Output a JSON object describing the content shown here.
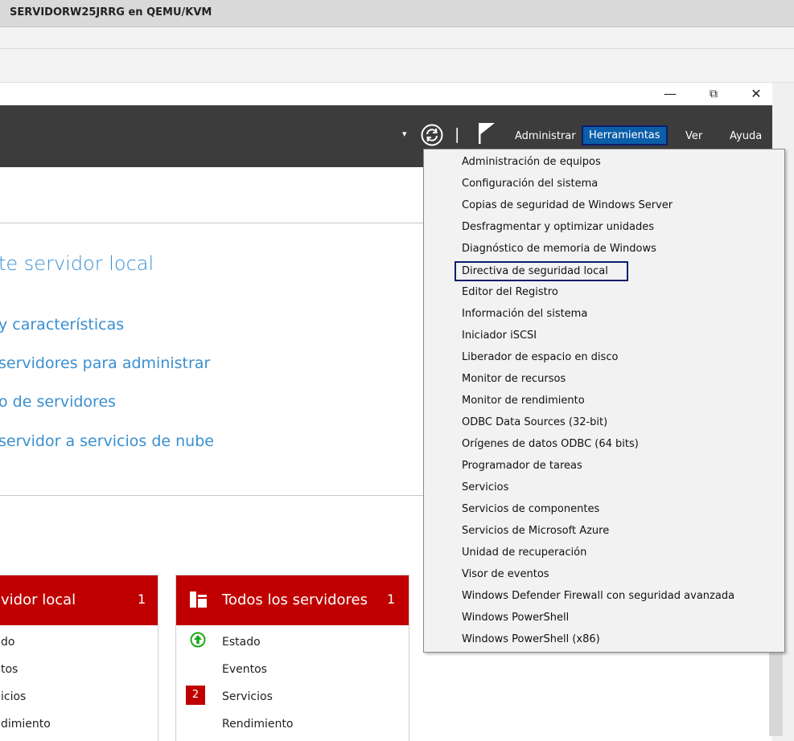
{
  "vm": {
    "title": "SERVIDORW25JRRG en QEMU/KVM"
  },
  "window_controls": {
    "minimize": "—",
    "restore": "⧉",
    "close": "✕"
  },
  "header": {
    "menu": {
      "administrar": "Administrar",
      "herramientas": "Herramientas",
      "ver": "Ver",
      "ayuda": "Ayuda"
    },
    "separator": "|",
    "dropdown_arrow": "▾"
  },
  "welcome": {
    "title": "te servidor local",
    "links": [
      "y características",
      "servidores para administrar",
      "o de servidores",
      "servidor a servicios de nube"
    ]
  },
  "tiles": [
    {
      "title": "vidor local",
      "count": "1",
      "rows": [
        "do",
        "tos",
        "icios",
        "dimiento"
      ]
    },
    {
      "title": "Todos los servidores",
      "count": "1",
      "rows": [
        "Estado",
        "Eventos",
        "Servicios",
        "Rendimiento"
      ],
      "badge": "2"
    }
  ],
  "tools_menu": {
    "items": [
      "Administración de equipos",
      "Configuración del sistema",
      "Copias de seguridad de Windows Server",
      "Desfragmentar y optimizar unidades",
      "Diagnóstico de memoria de Windows",
      "Directiva de seguridad local",
      "Editor del Registro",
      "Información del sistema",
      "Iniciador iSCSI",
      "Liberador de espacio en disco",
      "Monitor de recursos",
      "Monitor de rendimiento",
      "ODBC Data Sources (32-bit)",
      "Orígenes de datos ODBC (64 bits)",
      "Programador de tareas",
      "Servicios",
      "Servicios de componentes",
      "Servicios de Microsoft Azure",
      "Unidad de recuperación",
      "Visor de eventos",
      "Windows Defender Firewall con seguridad avanzada",
      "Windows PowerShell",
      "Windows PowerShell (x86)"
    ]
  },
  "colors": {
    "header_bg": "#3c3c3c",
    "accent_blue": "#0b5ea8",
    "tile_red": "#c00000",
    "link_blue": "#3a8fd0",
    "status_green": "#1aa81a"
  },
  "icons": [
    "refresh-icon",
    "flag-icon",
    "servers-icon",
    "status-up-icon"
  ]
}
